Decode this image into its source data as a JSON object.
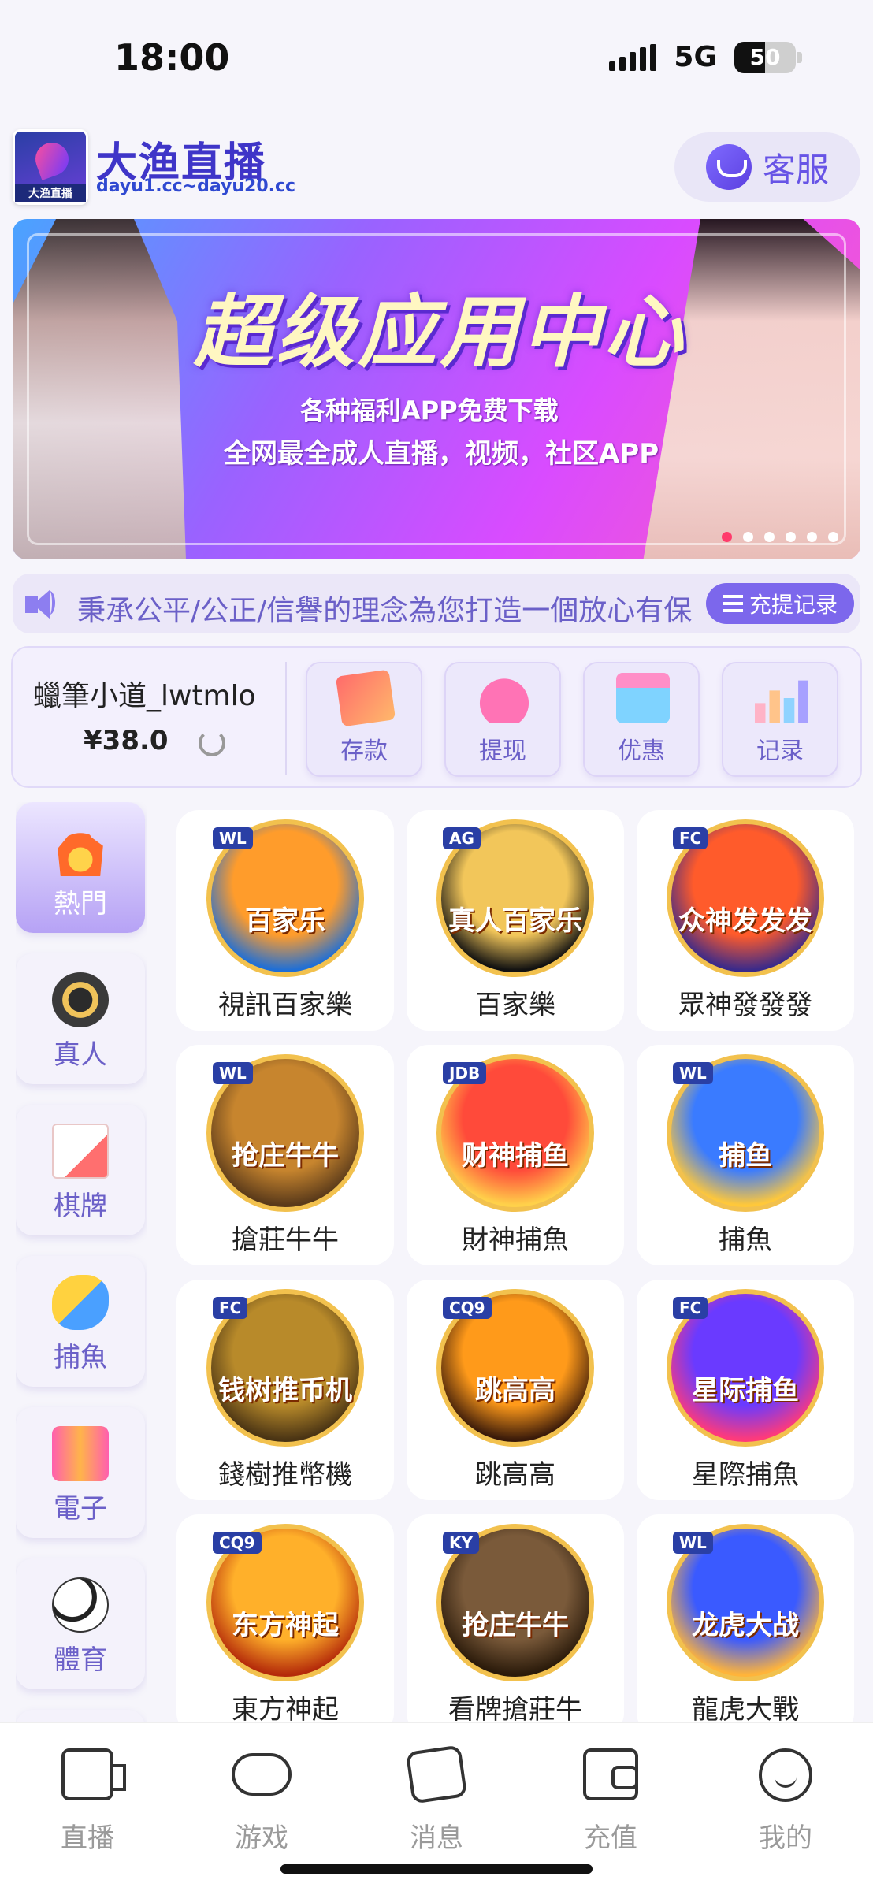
{
  "status": {
    "time": "18:00",
    "network": "5G",
    "battery_text": "50",
    "battery_level": 0.5
  },
  "header": {
    "logo_mini_text": "大渔直播",
    "brand_name": "大渔直播",
    "brand_url": "dayu1.cc~dayu20.cc",
    "cs_label": "客服",
    "cs_icon": "headset-icon"
  },
  "banner": {
    "title": "超级应用中心",
    "subtitle1": "各种福利APP免费下载",
    "subtitle2": "全网最全成人直播，视频，社区APP",
    "slide_count": 6,
    "active_slide": 0
  },
  "marquee": {
    "text": "秉承公平/公正/信譽的理念為您打造一個放心有保",
    "icon": "speaker-icon",
    "button_label": "充提记录"
  },
  "wallet": {
    "username": "蠟筆小道_lwtmlo",
    "balance": "¥38.0",
    "actions": [
      {
        "label": "存款",
        "icon": "card-icon"
      },
      {
        "label": "提现",
        "icon": "money-bag-icon"
      },
      {
        "label": "优惠",
        "icon": "gift-icon"
      },
      {
        "label": "记录",
        "icon": "bar-chart-icon"
      }
    ]
  },
  "categories": [
    {
      "label": "熱門",
      "icon": "fire-icon",
      "active": true
    },
    {
      "label": "真人",
      "icon": "chip-icon",
      "active": false
    },
    {
      "label": "棋牌",
      "icon": "playing-card-icon",
      "active": false
    },
    {
      "label": "捕魚",
      "icon": "shark-icon",
      "active": false
    },
    {
      "label": "電子",
      "icon": "slot-machine-icon",
      "active": false
    },
    {
      "label": "體育",
      "icon": "soccer-ball-icon",
      "active": false
    }
  ],
  "games": [
    {
      "name": "視訊百家樂",
      "tag": "WL",
      "art_text": "百家乐",
      "colors": [
        "#ff9c2b",
        "#1f6fd6"
      ]
    },
    {
      "name": "百家樂",
      "tag": "AG",
      "art_text": "真人百家乐",
      "colors": [
        "#f2c65a",
        "#111111"
      ]
    },
    {
      "name": "眾神發發發",
      "tag": "FC",
      "art_text": "众神发发发",
      "colors": [
        "#ff5b2b",
        "#3a2a8a"
      ]
    },
    {
      "name": "搶莊牛牛",
      "tag": "WL",
      "art_text": "抢庄牛牛",
      "colors": [
        "#c7852e",
        "#5a3a1a"
      ]
    },
    {
      "name": "財神捕魚",
      "tag": "JDB",
      "art_text": "财神捕鱼",
      "colors": [
        "#ff4a3a",
        "#ffd14a"
      ]
    },
    {
      "name": "捕魚",
      "tag": "WL",
      "art_text": "捕鱼",
      "colors": [
        "#3a7bff",
        "#ffc83a"
      ]
    },
    {
      "name": "錢樹推幣機",
      "tag": "FC",
      "art_text": "钱树推币机",
      "colors": [
        "#b88a2a",
        "#4a3414"
      ]
    },
    {
      "name": "跳高高",
      "tag": "CQ9",
      "art_text": "跳高高",
      "colors": [
        "#ff9a1a",
        "#3a1a0a"
      ]
    },
    {
      "name": "星際捕魚",
      "tag": "FC",
      "art_text": "星际捕鱼",
      "colors": [
        "#6a3aff",
        "#ff3a7a"
      ]
    },
    {
      "name": "東方神起",
      "tag": "CQ9",
      "art_text": "东方神起",
      "colors": [
        "#ffb02a",
        "#b42a0a"
      ]
    },
    {
      "name": "看牌搶莊牛",
      "tag": "KY",
      "art_text": "抢庄牛牛",
      "colors": [
        "#7a5a3a",
        "#2a1a0a"
      ]
    },
    {
      "name": "龍虎大戰",
      "tag": "WL",
      "art_text": "龙虎大战",
      "colors": [
        "#3a5aff",
        "#ffb43a"
      ]
    }
  ],
  "tabbar": [
    {
      "label": "直播",
      "icon": "video-camera-icon"
    },
    {
      "label": "游戏",
      "icon": "gamepad-icon"
    },
    {
      "label": "消息",
      "icon": "message-heart-icon"
    },
    {
      "label": "充值",
      "icon": "wallet-icon"
    },
    {
      "label": "我的",
      "icon": "smile-icon"
    }
  ]
}
